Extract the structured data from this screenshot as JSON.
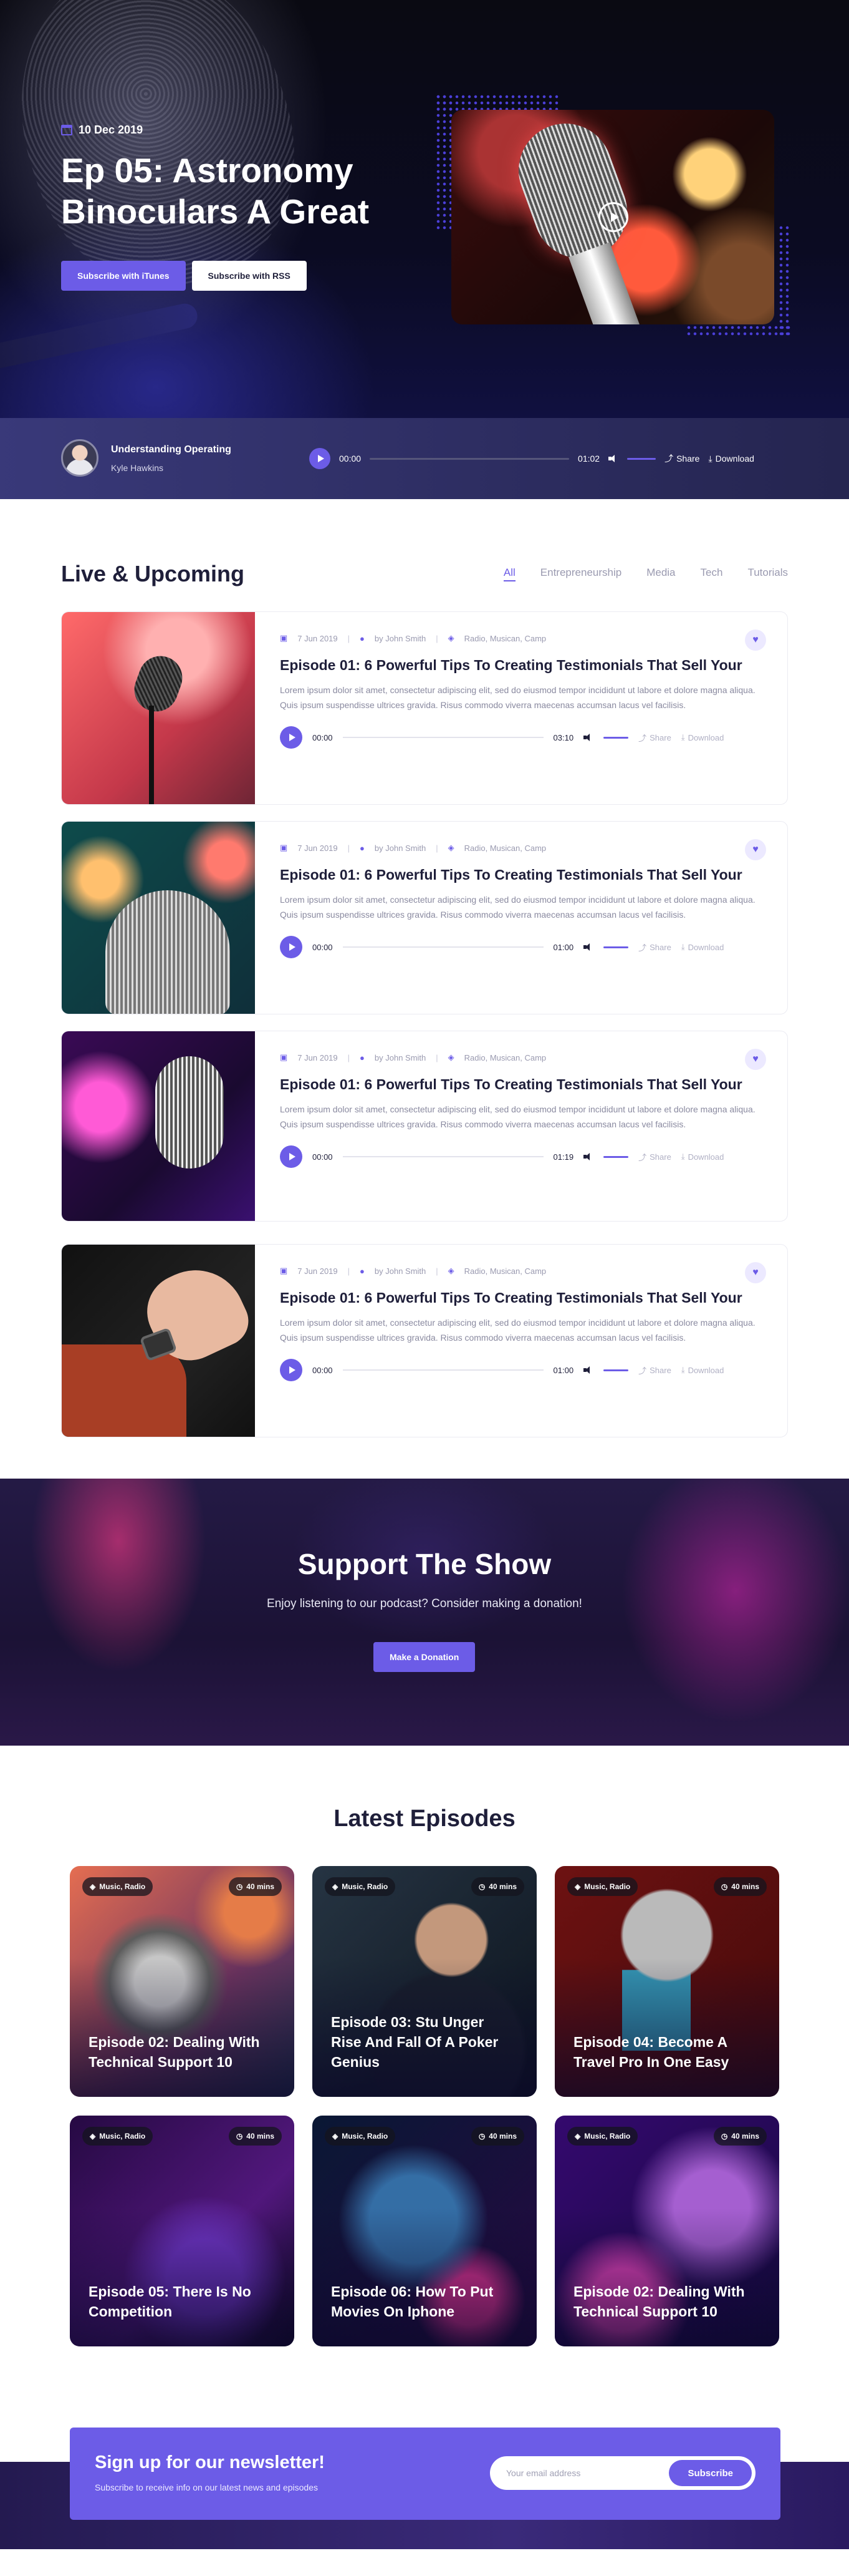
{
  "hero": {
    "date": "10 Dec 2019",
    "title": "Ep 05: Astronomy Binoculars A Great",
    "btn_itunes": "Subscribe with iTunes",
    "btn_rss": "Subscribe with RSS"
  },
  "player": {
    "track": "Understanding Operating",
    "artist": "Kyle Hawkins",
    "current_time": "00:00",
    "duration": "01:02",
    "progress": 0,
    "share": "Share",
    "download": "Download"
  },
  "live": {
    "title": "Live & Upcoming",
    "filters": [
      "All",
      "Entrepreneurship",
      "Media",
      "Tech",
      "Tutorials"
    ],
    "active_filter": "All",
    "episodes": [
      {
        "date": "7 Jun 2019",
        "author": "by John Smith",
        "tags": "Radio, Musican, Camp",
        "title": "Episode 01: 6 Powerful Tips To Creating Testimonials That Sell Your",
        "desc": "Lorem ipsum dolor sit amet, consectetur adipiscing elit, sed do eiusmod tempor incididunt ut labore et dolore magna aliqua. Quis ipsum suspendisse ultrices gravida. Risus commodo viverra maecenas accumsan lacus vel facilisis.",
        "current": "00:00",
        "duration": "03:10",
        "share": "Share",
        "download": "Download"
      },
      {
        "date": "7 Jun 2019",
        "author": "by John Smith",
        "tags": "Radio, Musican, Camp",
        "title": "Episode 01: 6 Powerful Tips To Creating Testimonials That Sell Your",
        "desc": "Lorem ipsum dolor sit amet, consectetur adipiscing elit, sed do eiusmod tempor incididunt ut labore et dolore magna aliqua. Quis ipsum suspendisse ultrices gravida. Risus commodo viverra maecenas accumsan lacus vel facilisis.",
        "current": "00:00",
        "duration": "01:00",
        "share": "Share",
        "download": "Download"
      },
      {
        "date": "7 Jun 2019",
        "author": "by John Smith",
        "tags": "Radio, Musican, Camp",
        "title": "Episode 01: 6 Powerful Tips To Creating Testimonials That Sell Your",
        "desc": "Lorem ipsum dolor sit amet, consectetur adipiscing elit, sed do eiusmod tempor incididunt ut labore et dolore magna aliqua. Quis ipsum suspendisse ultrices gravida. Risus commodo viverra maecenas accumsan lacus vel facilisis.",
        "current": "00:00",
        "duration": "01:19",
        "share": "Share",
        "download": "Download"
      },
      {
        "date": "7 Jun 2019",
        "author": "by John Smith",
        "tags": "Radio, Musican, Camp",
        "title": "Episode 01: 6 Powerful Tips To Creating Testimonials That Sell Your",
        "desc": "Lorem ipsum dolor sit amet, consectetur adipiscing elit, sed do eiusmod tempor incididunt ut labore et dolore magna aliqua. Quis ipsum suspendisse ultrices gravida. Risus commodo viverra maecenas accumsan lacus vel facilisis.",
        "current": "00:00",
        "duration": "01:00",
        "share": "Share",
        "download": "Download"
      }
    ]
  },
  "support": {
    "title": "Support The Show",
    "subtitle": "Enjoy listening to our podcast? Consider making a donation!",
    "button": "Make a Donation"
  },
  "latest": {
    "title": "Latest Episodes",
    "cards": [
      {
        "tag": "Music, Radio",
        "duration": "40 mins",
        "title": "Episode 02: Dealing With Technical Support 10"
      },
      {
        "tag": "Music, Radio",
        "duration": "40 mins",
        "title": "Episode 03: Stu Unger Rise And Fall Of A Poker Genius"
      },
      {
        "tag": "Music, Radio",
        "duration": "40 mins",
        "title": "Episode 04: Become A Travel Pro In One Easy"
      },
      {
        "tag": "Music, Radio",
        "duration": "40 mins",
        "title": "Episode 05: There Is No Competition"
      },
      {
        "tag": "Music, Radio",
        "duration": "40 mins",
        "title": "Episode 06: How To Put Movies On Iphone"
      },
      {
        "tag": "Music, Radio",
        "duration": "40 mins",
        "title": "Episode 02: Dealing With Technical Support 10"
      }
    ]
  },
  "newsletter": {
    "title": "Sign up for our newsletter!",
    "subtitle": "Subscribe to receive info on our latest news and episodes",
    "placeholder": "Your email address",
    "button": "Subscribe"
  },
  "colors": {
    "accent": "#6c5ce7",
    "dark": "#1f1f3a"
  },
  "icons": {
    "date": "calendar-icon",
    "author": "user-icon",
    "tags": "tag-icon",
    "play": "play-icon",
    "volume": "volume-icon",
    "share": "share-icon",
    "download": "download-icon",
    "favorite": "heart-icon",
    "duration": "clock-icon"
  }
}
